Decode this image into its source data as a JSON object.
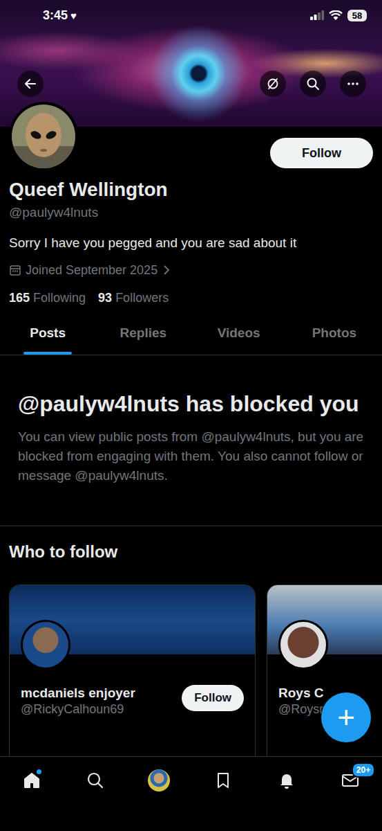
{
  "status_bar": {
    "time": "3:45",
    "heart": "♥",
    "battery": "58"
  },
  "profile": {
    "name": "Queef Wellington",
    "handle": "@paulyw4lnuts",
    "bio": "Sorry I have you pegged and you are sad about it",
    "joined": "Joined September 2025",
    "following_count": "165",
    "following_label": "Following",
    "followers_count": "93",
    "followers_label": "Followers",
    "follow_button": "Follow"
  },
  "tabs": [
    {
      "label": "Posts",
      "selected": true
    },
    {
      "label": "Replies",
      "selected": false
    },
    {
      "label": "Videos",
      "selected": false
    },
    {
      "label": "Photos",
      "selected": false
    }
  ],
  "blocked": {
    "title": "@paulyw4lnuts has blocked you",
    "body": "You can view public posts from @paulyw4lnuts, but you are blocked from engaging with them. You also cannot follow or message @paulyw4lnuts."
  },
  "who_to_follow": {
    "title": "Who to follow",
    "cards": [
      {
        "name": "mcdaniels enjoyer",
        "handle": "@RickyCalhoun69",
        "button": "Follow"
      },
      {
        "name": "Roys C",
        "handle": "@Roysrocker"
      }
    ]
  },
  "fab": {
    "label": "+"
  },
  "nav": [
    {
      "kind": "home",
      "selected": true,
      "dot": true,
      "badge": ""
    },
    {
      "kind": "search",
      "selected": false,
      "dot": false,
      "badge": ""
    },
    {
      "kind": "avatar",
      "selected": false,
      "dot": false,
      "badge": ""
    },
    {
      "kind": "bookmark",
      "selected": false,
      "dot": false,
      "badge": ""
    },
    {
      "kind": "bell",
      "selected": false,
      "dot": false,
      "badge": ""
    },
    {
      "kind": "mail",
      "selected": false,
      "dot": false,
      "badge": "20+"
    }
  ]
}
